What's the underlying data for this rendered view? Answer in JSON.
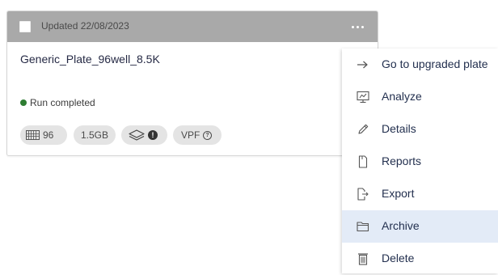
{
  "card": {
    "updated_label": "Updated 22/08/2023",
    "more_icon": "more-horizontal-icon",
    "title": "Generic_Plate_96well_8.5K",
    "status": {
      "label": "Run completed",
      "color": "#2e7d32"
    },
    "chips": {
      "wells": "96",
      "size": "1.5GB",
      "layers_icon": "layers-icon",
      "warning_glyph": "!",
      "vpf": "VPF",
      "help_glyph": "?"
    },
    "header_color": "#a9a9a9"
  },
  "menu": {
    "active_color": "#e3ebf7",
    "items": [
      {
        "label": "Go to upgraded plate",
        "icon": "arrow-right-icon"
      },
      {
        "label": "Analyze",
        "icon": "analyze-icon"
      },
      {
        "label": "Details",
        "icon": "pencil-icon"
      },
      {
        "label": "Reports",
        "icon": "document-icon"
      },
      {
        "label": "Export",
        "icon": "export-icon"
      },
      {
        "label": "Archive",
        "icon": "folder-icon",
        "active": true
      },
      {
        "label": "Delete",
        "icon": "trash-icon"
      }
    ]
  }
}
